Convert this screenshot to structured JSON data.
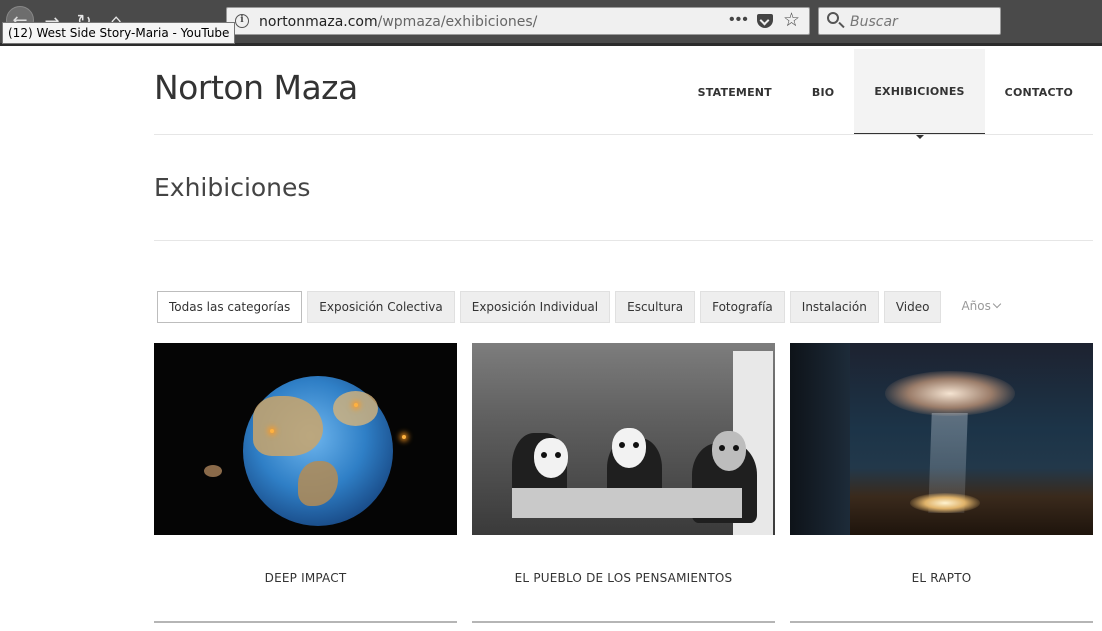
{
  "browser": {
    "tooltip": "(12) West Side Story-Maria - YouTube",
    "url_domain": "nortonmaza.com",
    "url_path": "/wpmaza/exhibiciones/",
    "search_placeholder": "Buscar",
    "menu_dots": "•••"
  },
  "site": {
    "title": "Norton Maza",
    "nav": [
      {
        "label": "STATEMENT",
        "active": false
      },
      {
        "label": "BIO",
        "active": false
      },
      {
        "label": "EXHIBICIONES",
        "active": true
      },
      {
        "label": "CONTACTO",
        "active": false
      }
    ]
  },
  "page": {
    "title": "Exhibiciones",
    "filters": [
      {
        "label": "Todas las categorías",
        "active": true
      },
      {
        "label": "Exposición Colectiva",
        "active": false
      },
      {
        "label": "Exposición Individual",
        "active": false
      },
      {
        "label": "Escultura",
        "active": false
      },
      {
        "label": "Fotografía",
        "active": false
      },
      {
        "label": "Instalación",
        "active": false
      },
      {
        "label": "Video",
        "active": false
      }
    ],
    "years_label": "Años",
    "exhibitions": [
      {
        "title": "DEEP IMPACT"
      },
      {
        "title": "EL PUEBLO DE LOS PENSAMIENTOS"
      },
      {
        "title": "EL RAPTO"
      }
    ]
  }
}
